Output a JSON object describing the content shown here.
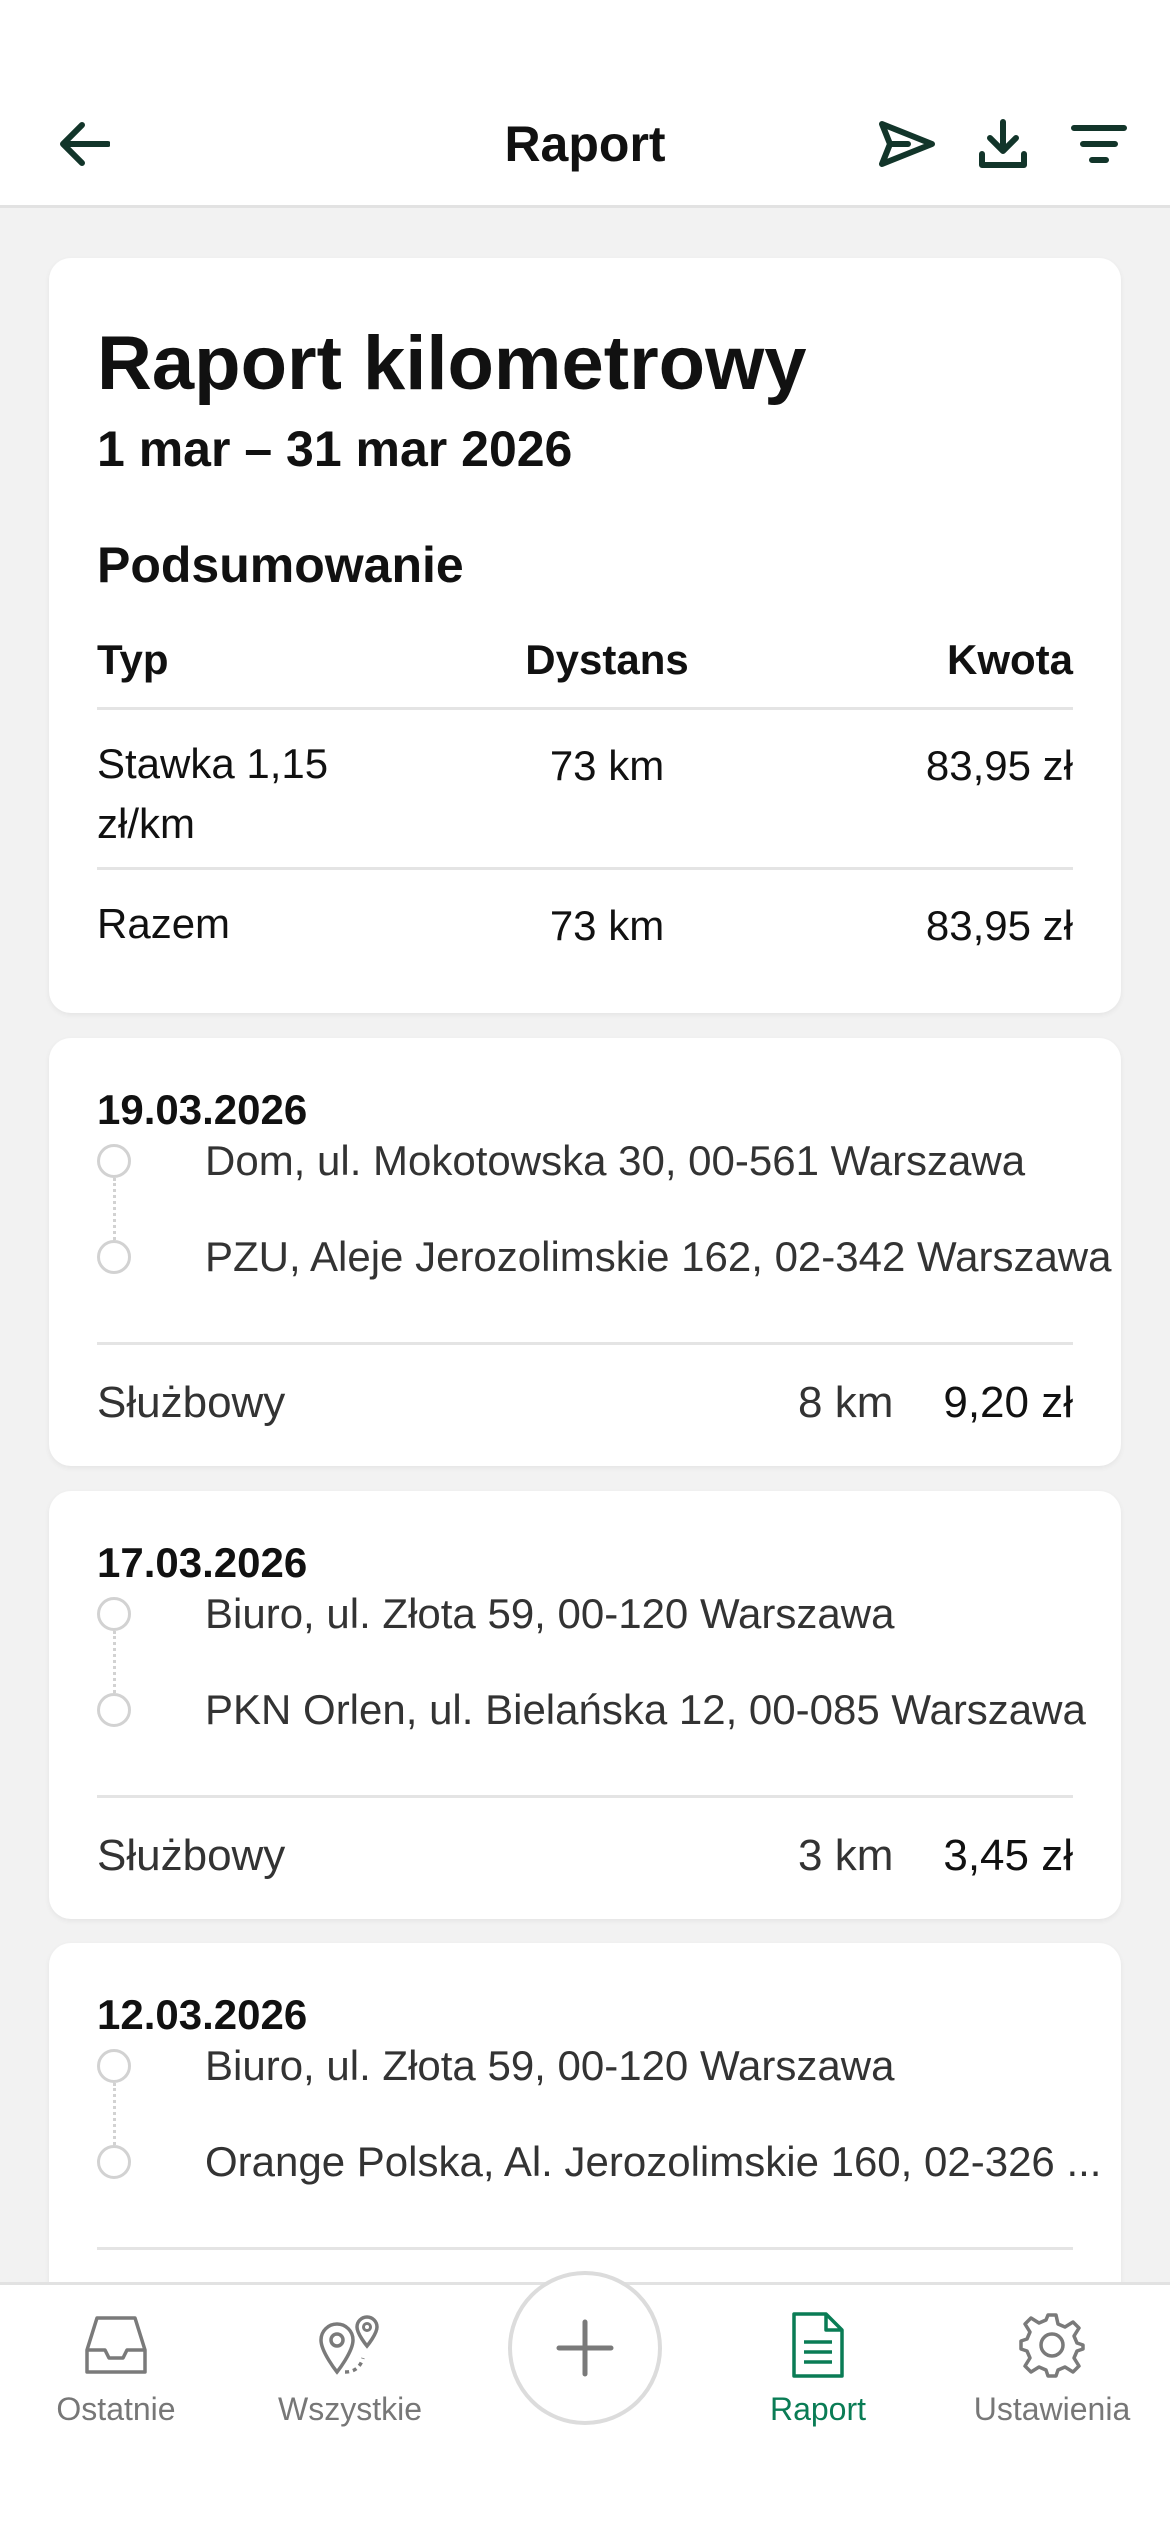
{
  "header": {
    "title": "Raport",
    "icons": [
      "back-arrow-icon",
      "send-icon",
      "download-icon",
      "filter-icon"
    ]
  },
  "summary": {
    "title": "Raport kilometrowy",
    "range": "1 mar – 31 mar 2026",
    "section": "Podsumowanie",
    "columns": {
      "type": "Typ",
      "distance": "Dystans",
      "amount": "Kwota"
    },
    "rows": [
      {
        "type": "Stawka 1,15 zł/km",
        "distance": "73 km",
        "amount": "83,95 zł"
      },
      {
        "type": "Razem",
        "distance": "73 km",
        "amount": "83,95 zł"
      }
    ]
  },
  "trips": [
    {
      "date": "19.03.2026",
      "from": "Dom, ul. Mokotowska 30, 00-561 Warszawa",
      "to": "PZU, Aleje Jerozolimskie 162, 02-342 Warszawa",
      "type": "Służbowy",
      "distance": "8 km",
      "amount": "9,20 zł"
    },
    {
      "date": "17.03.2026",
      "from": "Biuro, ul. Złota 59, 00-120 Warszawa",
      "to": "PKN Orlen, ul. Bielańska 12, 00-085 Warszawa",
      "type": "Służbowy",
      "distance": "3 km",
      "amount": "3,45 zł"
    },
    {
      "date": "12.03.2026",
      "from": "Biuro, ul. Złota 59, 00-120 Warszawa",
      "to": "Orange Polska, Al. Jerozolimskie 160, 02-326 ..."
    }
  ],
  "nav": {
    "items": [
      {
        "label": "Ostatnie",
        "icon": "inbox-icon"
      },
      {
        "label": "Wszystkie",
        "icon": "map-pins-icon"
      },
      {
        "label": "Raport",
        "icon": "document-icon",
        "active": true
      },
      {
        "label": "Ustawienia",
        "icon": "gear-icon"
      }
    ],
    "add_icon": "plus-icon"
  },
  "colors": {
    "accent": "#0a7c55",
    "header_icon": "#12352a",
    "background": "#f2f2f2"
  }
}
